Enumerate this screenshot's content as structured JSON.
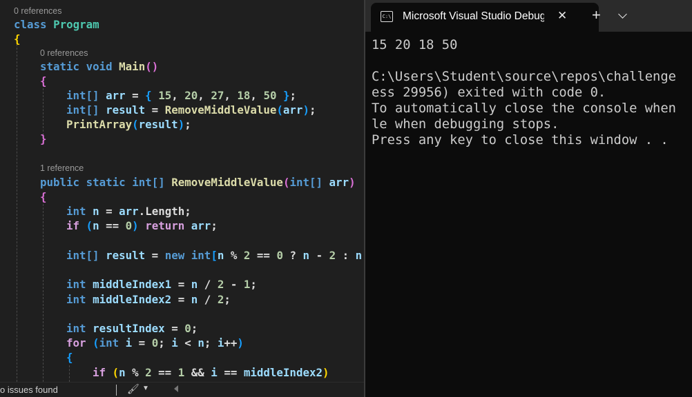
{
  "editor": {
    "lens": {
      "class_refs": "0 references",
      "main_refs": "0 references",
      "remove_refs": "1 reference"
    },
    "code": {
      "class_kw": "class",
      "class_name": "Program",
      "static": "static",
      "void": "void",
      "main": "Main",
      "int_arr": "int[]",
      "arr": "arr",
      "arr_init_vals": [
        "15",
        "20",
        "27",
        "18",
        "50"
      ],
      "result": "result",
      "remove_fn": "RemoveMiddleValue",
      "print_fn": "PrintArray",
      "public": "public",
      "int": "int",
      "n": "n",
      "length": "Length",
      "if": "if",
      "return": "return",
      "new": "new",
      "zero": "0",
      "one": "1",
      "two": "2",
      "middle1": "middleIndex1",
      "middle2": "middleIndex2",
      "result_index": "resultIndex",
      "for": "for",
      "i": "i"
    },
    "status": {
      "issues": "o issues found"
    }
  },
  "terminal": {
    "tab_title": "Microsoft Visual Studio Debug Console",
    "tab_icon": "console-icon",
    "close_glyph": "✕",
    "new_tab_glyph": "+",
    "lines": [
      "15 20 18 50",
      "",
      "C:\\Users\\Student\\source\\repos\\challenge",
      "ess 29956) exited with code 0.",
      "To automatically close the console when",
      "le when debugging stops.",
      "Press any key to close this window . ."
    ]
  }
}
